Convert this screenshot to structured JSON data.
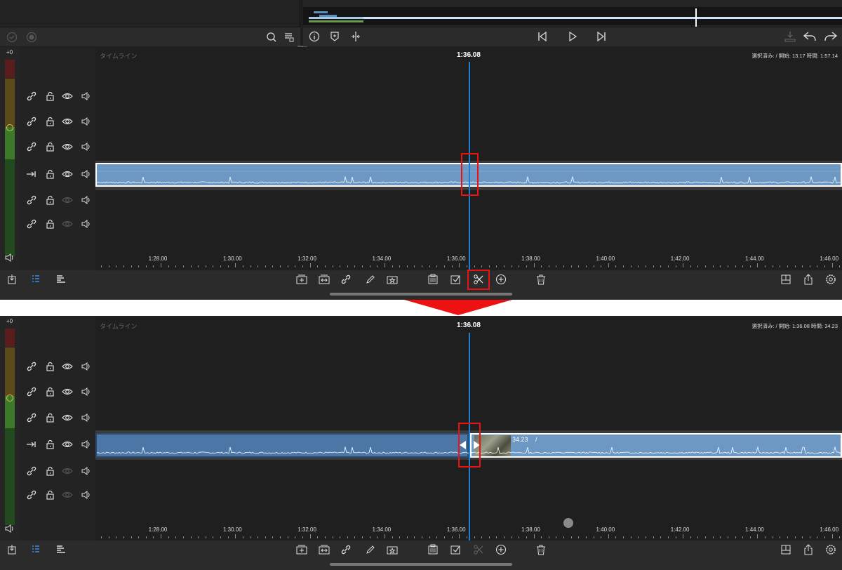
{
  "panel1": {
    "timeline_label": "タイムライン",
    "playhead_time": "1:36.08",
    "selection_info": "選択済み: / 開始: 13.17 時間: 1:57.14",
    "db_label": "+0"
  },
  "panel2": {
    "timeline_label": "タイムライン",
    "playhead_time": "1:36.08",
    "selection_info": "選択済み: / 開始: 1:36.08 時間: 34.23",
    "db_label": "+0",
    "clip_label": "34.23",
    "clip_label_slash": "/"
  },
  "ruler": [
    "1:28.00",
    "1:30.00",
    "1:32.00",
    "1:34.00",
    "1:36.00",
    "1:38.00",
    "1:40.00",
    "1:42.00",
    "1:44.00",
    "1:46.00"
  ],
  "colors": {
    "accent": "#1f7fd0",
    "clip": "#6d98c4",
    "highlight": "#e11111"
  },
  "icons": {
    "library_toolbar": [
      "check-circle-icon",
      "record-icon",
      "search-icon",
      "list-filter-icon"
    ],
    "viewer_left": [
      "info-icon",
      "marker-icon",
      "split-view-icon"
    ],
    "transport": [
      "skip-back-icon",
      "play-icon",
      "skip-forward-icon"
    ],
    "viewer_right": [
      "audio-export-icon",
      "undo-icon",
      "redo-icon"
    ],
    "bottom_left": [
      "import-icon",
      "clip-list-icon",
      "tracks-icon"
    ],
    "bottom_center": [
      "insert-icon",
      "overwrite-icon",
      "link-icon",
      "pencil-icon",
      "favorite-icon",
      "clipboard-icon",
      "checkbox-icon",
      "scissors-icon",
      "add-icon",
      "trash-icon"
    ],
    "bottom_right": [
      "layout-icon",
      "share-icon",
      "settings-icon"
    ]
  }
}
